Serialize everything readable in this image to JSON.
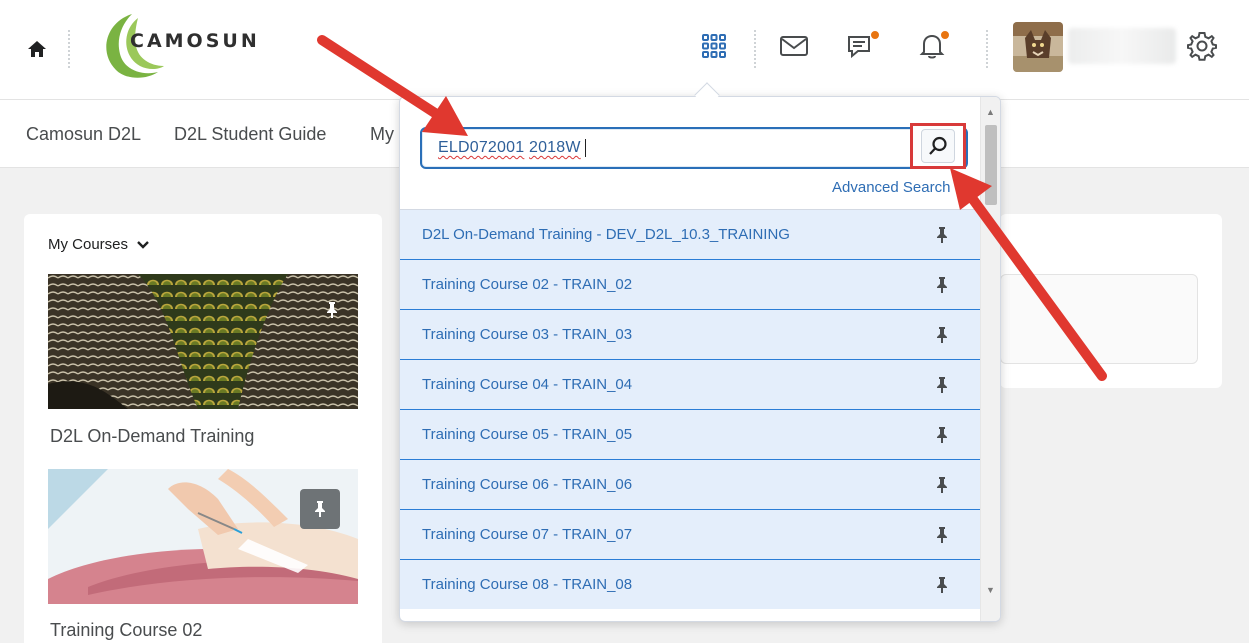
{
  "header": {
    "logo_text": "CAMOSUN",
    "icons": [
      "home-icon",
      "course-selector-grid-icon",
      "message-alerts-icon",
      "subscription-alerts-icon",
      "update-alerts-icon",
      "settings-gear-icon"
    ],
    "badge_color": "#e87511"
  },
  "navbar": {
    "links": [
      "Camosun D2L",
      "D2L Student Guide",
      "My"
    ]
  },
  "widget": {
    "title": "My Courses",
    "courses": [
      {
        "name": "D2L On-Demand Training",
        "pinned": true
      },
      {
        "name": "Training Course 02",
        "pinned": true
      }
    ]
  },
  "course_selector": {
    "search_value_parts": [
      "ELD072001",
      "2018W"
    ],
    "advanced_search_label": "Advanced Search",
    "items": [
      "D2L On-Demand Training - DEV_D2L_10.3_TRAINING",
      "Training Course 02 - TRAIN_02",
      "Training Course 03 - TRAIN_03",
      "Training Course 04 - TRAIN_04",
      "Training Course 05 - TRAIN_05",
      "Training Course 06 - TRAIN_06",
      "Training Course 07 - TRAIN_07",
      "Training Course 08 - TRAIN_08"
    ]
  },
  "colors": {
    "link": "#2e6db4",
    "row_bg": "#e4eefb",
    "annotation_red": "#e0382f",
    "logo_green": "#7ab342"
  }
}
